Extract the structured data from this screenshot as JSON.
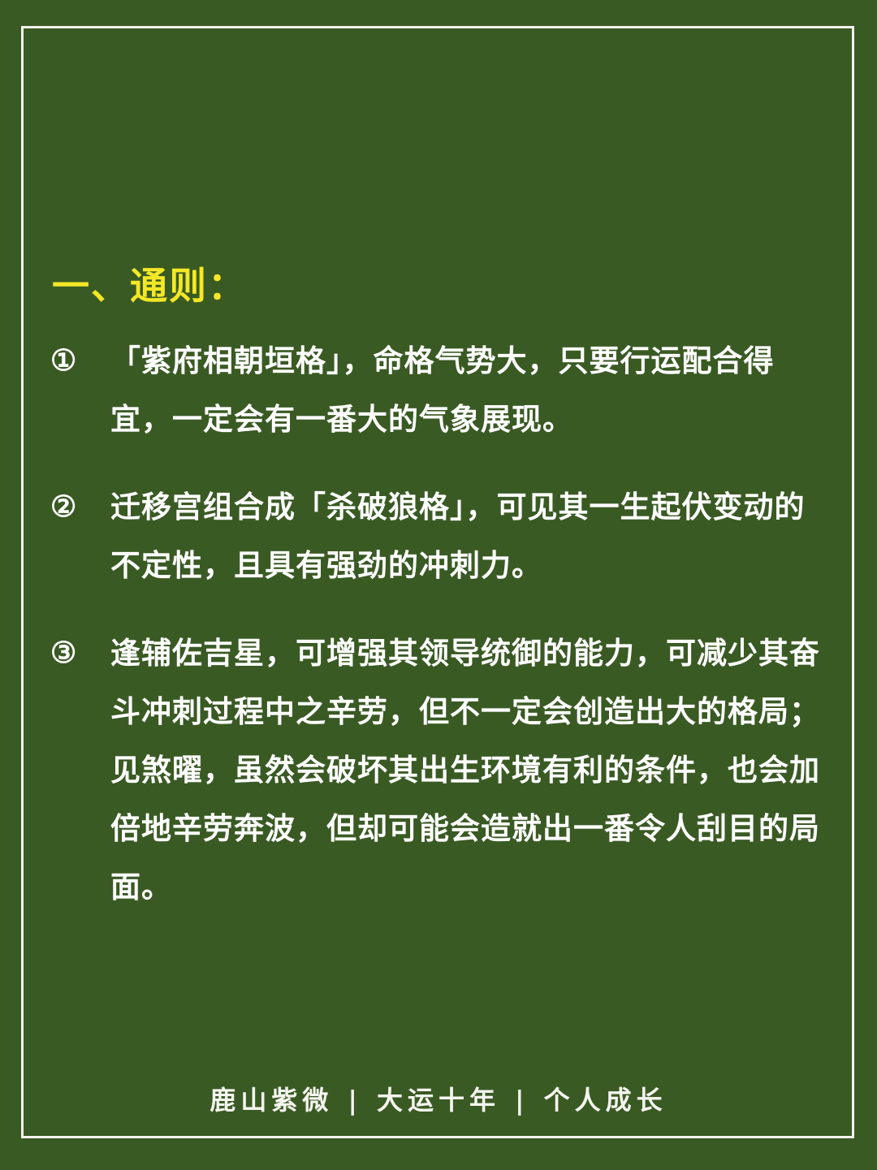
{
  "heading": "一、通则：",
  "items": [
    {
      "num": "①",
      "text": "「紫府相朝垣格」，命格气势大，只要行运配合得宜，一定会有一番大的气象展现。"
    },
    {
      "num": "②",
      "text": "迁移宫组合成「杀破狼格」，可见其一生起伏变动的不定性，且具有强劲的冲刺力。"
    },
    {
      "num": "③",
      "text": "逢辅佐吉星，可增强其领导统御的能力，可减少其奋斗冲刺过程中之辛劳，但不一定会创造出大的格局；见煞曜，虽然会破坏其出生环境有利的条件，也会加倍地辛劳奔波，但却可能会造就出一番令人刮目的局面。"
    }
  ],
  "footer": {
    "part1": "鹿山紫微",
    "sep": "|",
    "part2": "大运十年",
    "part3": "个人成长"
  },
  "colors": {
    "background": "#3a5a24",
    "heading": "#f4e826",
    "text": "#ffffff",
    "border": "#f2f2ee"
  }
}
